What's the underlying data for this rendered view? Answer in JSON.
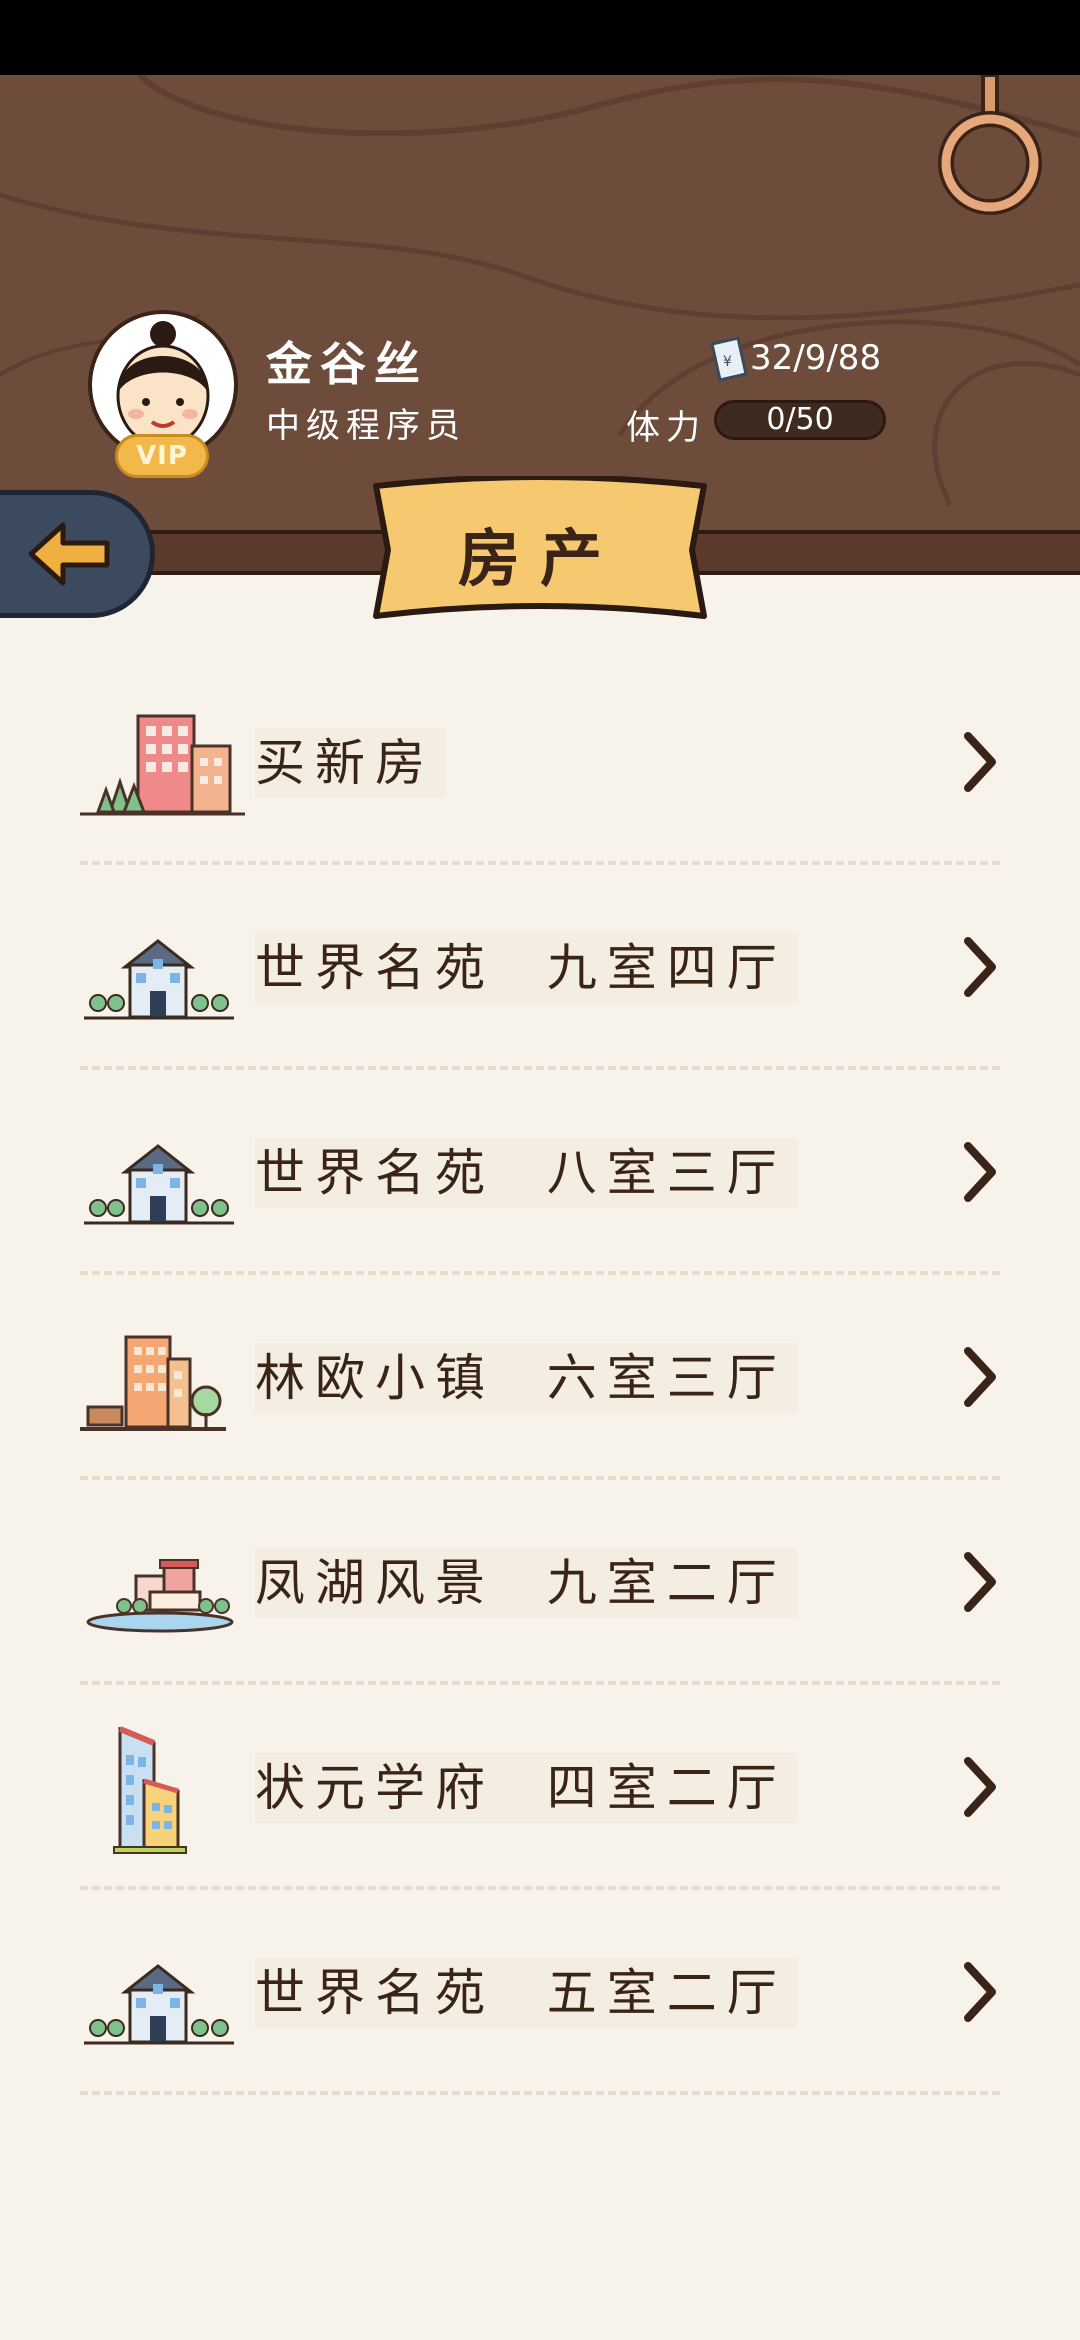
{
  "profile": {
    "name": "金谷丝",
    "title": "中级程序员",
    "vip_label": "VIP",
    "money": "32/9/88",
    "stamina_label": "体力",
    "stamina_value": "0/50"
  },
  "page": {
    "title": "房产"
  },
  "colors": {
    "header_wood": "#6e4c3c",
    "banner_yellow": "#f6c970",
    "back_button": "#3c4a60",
    "arrow_orange": "#f0b040",
    "background": "#f7f3ea",
    "text_dark": "#3a2418"
  },
  "properties": [
    {
      "label": "买新房",
      "icon": "apartment-buildings-icon"
    },
    {
      "label": "世界名苑  九室四厅",
      "icon": "house-icon"
    },
    {
      "label": "世界名苑  八室三厅",
      "icon": "house-icon"
    },
    {
      "label": "林欧小镇  六室三厅",
      "icon": "town-building-icon"
    },
    {
      "label": "凤湖风景  九室二厅",
      "icon": "lakeside-villa-icon"
    },
    {
      "label": "状元学府  四室二厅",
      "icon": "tower-icon"
    },
    {
      "label": "世界名苑  五室二厅",
      "icon": "house-icon"
    }
  ]
}
